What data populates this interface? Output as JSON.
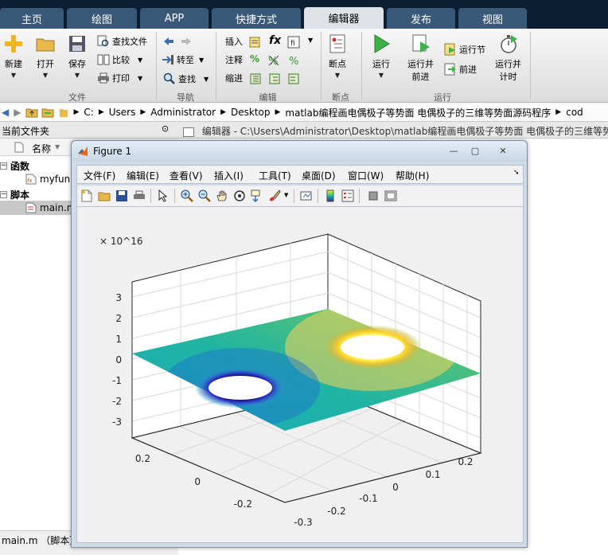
{
  "tabs": [
    "主页",
    "绘图",
    "APP",
    "快捷方式",
    "编辑器",
    "发布",
    "视图"
  ],
  "active_tab": "编辑器",
  "ribbon": {
    "file_group": {
      "label": "文件",
      "new": "新建",
      "open": "打开",
      "save": "保存",
      "find_files": "查找文件",
      "compare": "比较",
      "print": "打印"
    },
    "nav_group": {
      "label": "导航",
      "goto": "转至",
      "find": "查找"
    },
    "edit_group": {
      "label": "编辑",
      "insert": "插入",
      "comment": "注释",
      "indent": "缩进"
    },
    "breakpoint_group": {
      "label": "断点",
      "breakpoints": "断点"
    },
    "run_group": {
      "label": "运行",
      "run": "运行",
      "run_advance_1": "运行并",
      "run_advance_2": "前进",
      "run_section": "运行节",
      "advance": "前进",
      "run_time_1": "运行并",
      "run_time_2": "计时"
    }
  },
  "address_bar": {
    "crumbs": [
      "C:",
      "Users",
      "Administrator",
      "Desktop",
      "matlab编程画电偶极子等势面 电偶极子的三维等势面源码程序",
      "cod"
    ]
  },
  "left_panel": {
    "title": "当前文件夹",
    "column_name": "名称",
    "tree": [
      {
        "label": "函数",
        "type": "group"
      },
      {
        "label": "myfun",
        "type": "file"
      },
      {
        "label": "脚本",
        "type": "group"
      },
      {
        "label": "main.m",
        "type": "file",
        "selected": true
      }
    ],
    "status": "main.m （脚本）"
  },
  "editor": {
    "title": "编辑器 - C:\\Users\\Administrator\\Desktop\\matlab编程画电偶极子等势面 电偶极子的三维等势"
  },
  "figure": {
    "title": "Figure 1",
    "menu": [
      "文件(F)",
      "编辑(E)",
      "查看(V)",
      "插入(I)",
      "工具(T)",
      "桌面(D)",
      "窗口(W)",
      "帮助(H)"
    ]
  },
  "chart_data": {
    "type": "surface",
    "title": "",
    "exponent_label": "× 10^16",
    "z_ticks": [
      "3",
      "2",
      "1",
      "0",
      "-1",
      "-2",
      "-3"
    ],
    "x_ticks": [
      "-0.3",
      "-0.2",
      "-0.1",
      "0",
      "0.1",
      "0.2"
    ],
    "y_ticks": [
      "0.2",
      "0",
      "-0.2"
    ],
    "zlim": [
      -3.5,
      3.5
    ],
    "description_features": {
      "negative_pole": "blue ring",
      "positive_pole": "yellow ring",
      "colormap": "parula"
    },
    "grid": true
  }
}
